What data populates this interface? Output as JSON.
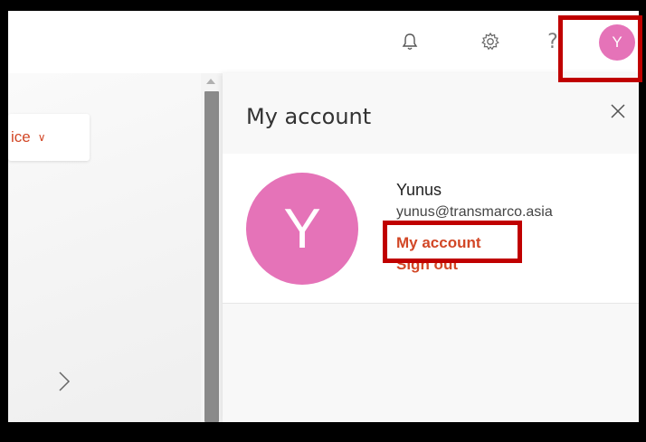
{
  "topbar": {
    "icons": [
      "bell-icon",
      "gear-icon",
      "help-icon"
    ],
    "help_glyph": "?",
    "avatar_initial": "Y"
  },
  "left": {
    "office_label": "ice",
    "office_chevron": "∨"
  },
  "panel": {
    "title": "My account",
    "avatar_initial": "Y",
    "user": {
      "name": "Yunus",
      "email": "yunus@transmarco.asia"
    },
    "links": {
      "my_account": "My account",
      "sign_out": "Sign out"
    }
  },
  "colors": {
    "accent": "#d24726",
    "avatar": "#e573b8",
    "highlight": "#c00000"
  }
}
